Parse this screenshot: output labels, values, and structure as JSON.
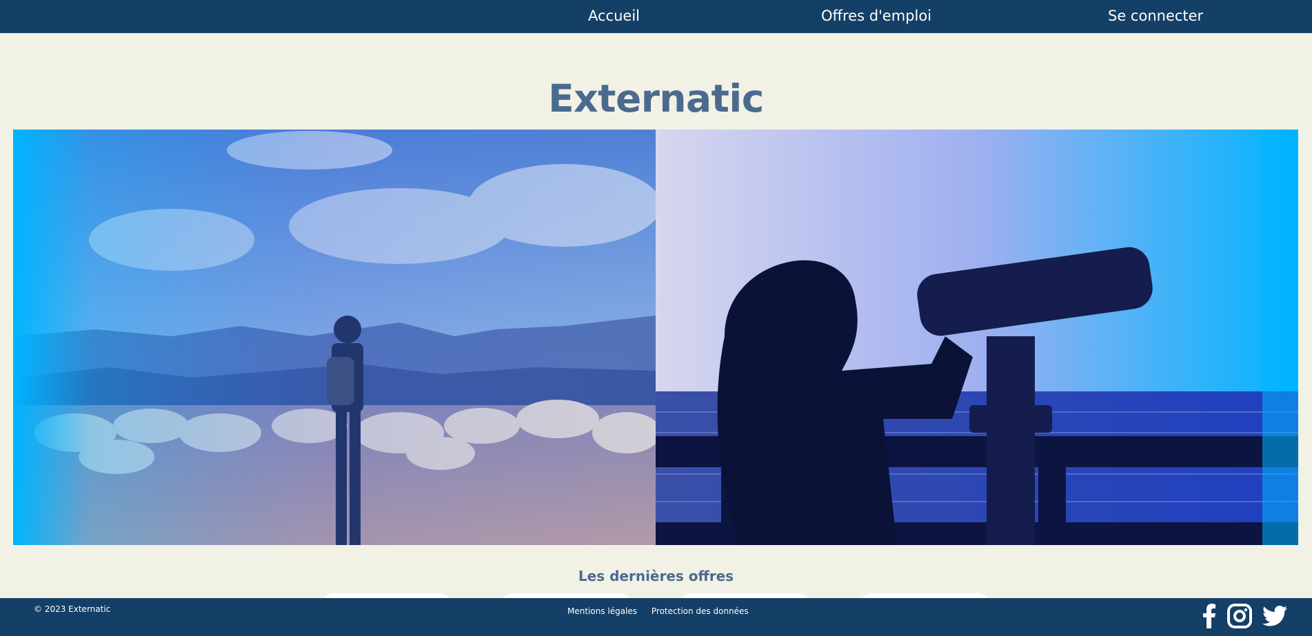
{
  "nav": {
    "home": "Accueil",
    "jobs": "Offres d'emploi",
    "login": "Se connecter"
  },
  "hero": {
    "title": "Externatic"
  },
  "offers": {
    "title": "Les dernières offres"
  },
  "footer": {
    "copyright": "© 2023 Externatic",
    "legal": "Mentions légales",
    "privacy": "Protection des données"
  },
  "social": [
    "facebook-icon",
    "instagram-icon",
    "twitter-icon"
  ],
  "colors": {
    "nav_bg": "#143f66",
    "page_bg": "#f2f1e6",
    "title": "#4a6a8e",
    "gradient_blue": "#00b4ff"
  }
}
